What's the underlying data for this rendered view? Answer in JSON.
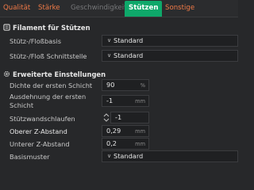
{
  "tabs": [
    {
      "label": "Qualität",
      "state": "normal"
    },
    {
      "label": "Stärke",
      "state": "normal"
    },
    {
      "label": "Geschwindigkeit",
      "state": "disabled"
    },
    {
      "label": "Stützen",
      "state": "active"
    },
    {
      "label": "Sonstige",
      "state": "normal"
    }
  ],
  "filament_section": {
    "title": "Filament für Stützen",
    "icon": "spool-icon",
    "rows": [
      {
        "label": "Stütz-/Floßbasis",
        "value": "Standard"
      },
      {
        "label": "Stütz-/Floß Schnittstelle",
        "value": "Standard"
      }
    ]
  },
  "advanced_section": {
    "title": "Erweiterte Einstellungen",
    "icon": "gear-icon",
    "first_layer_density": {
      "label": "Dichte der ersten Schicht",
      "value": "90",
      "unit": "%"
    },
    "first_layer_expansion": {
      "label": "Ausdehnung der ersten Schicht",
      "value": "-1",
      "unit": "mm"
    },
    "wall_loops": {
      "label": "Stützwandschlaufen",
      "value": "-1"
    },
    "top_z_distance": {
      "label": "Oberer Z-Abstand",
      "value": "0,29",
      "unit": "mm"
    },
    "bottom_z_distance": {
      "label": "Unterer Z-Abstand",
      "value": "0,2",
      "unit": "mm"
    },
    "base_pattern": {
      "label": "Basismuster",
      "value": "Standard"
    }
  },
  "colors": {
    "accent": "#0ea86a",
    "tab_text": "#f07a47",
    "background": "#27282a"
  }
}
